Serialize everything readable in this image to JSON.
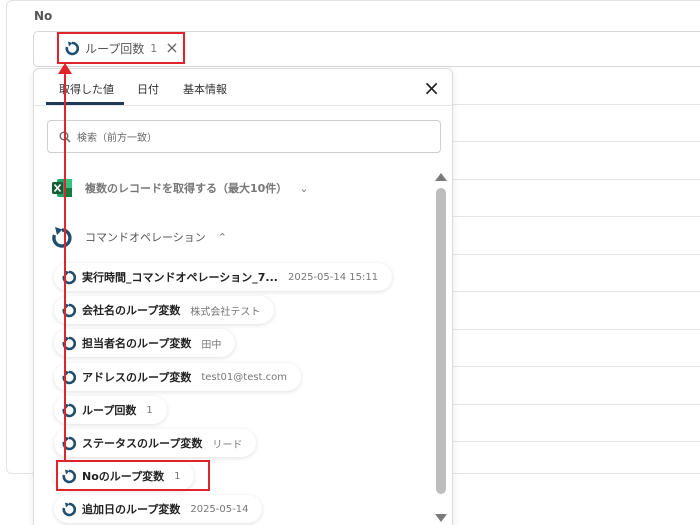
{
  "field": {
    "label": "No"
  },
  "selected_chip": {
    "label": "ループ回数",
    "value": "1",
    "remove": "×"
  },
  "tabs": [
    {
      "label": "取得した値",
      "active": true
    },
    {
      "label": "日付"
    },
    {
      "label": "基本情報"
    }
  ],
  "close_label": "×",
  "search": {
    "placeholder": "検索（前方一致）"
  },
  "sections": [
    {
      "title": "複数のレコードを取得する（最大10件）",
      "icon": "excel-icon",
      "chevron": "⌄"
    },
    {
      "title": "コマンドオペレーション",
      "icon": "loop-icon",
      "chevron": "⌃"
    }
  ],
  "items": [
    {
      "name": "実行時間_コマンドオペレーション_7...",
      "value": "2025-05-14 15:11"
    },
    {
      "name": "会社名のループ変数",
      "value": "株式会社テスト"
    },
    {
      "name": "担当者名のループ変数",
      "value": "田中"
    },
    {
      "name": "アドレスのループ変数",
      "value": "test01@test.com"
    },
    {
      "name": "ループ回数",
      "value": "1"
    },
    {
      "name": "ステータスのループ変数",
      "value": "リード"
    },
    {
      "name": "Noのループ変数",
      "value": "1"
    },
    {
      "name": "追加日のループ変数",
      "value": "2025-05-14"
    }
  ],
  "colors": {
    "accent_red": "#e0242c",
    "tab_underline": "#1f3b57",
    "loop_icon": "#1f4e6e",
    "excel_green": "#1d7a45"
  }
}
